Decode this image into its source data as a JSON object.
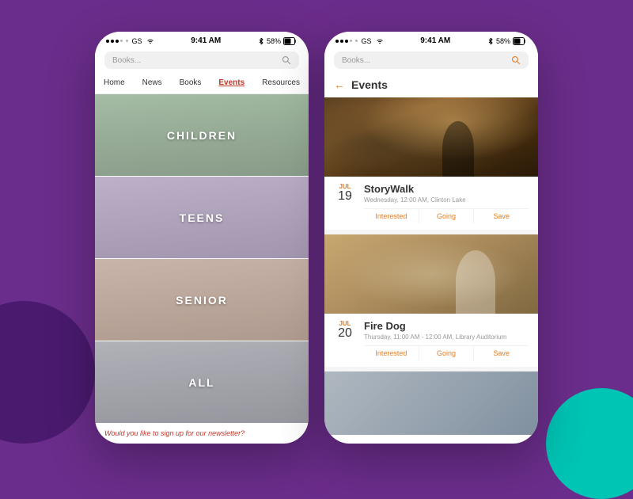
{
  "background": {
    "color": "#6b2d8b"
  },
  "phone1": {
    "statusBar": {
      "carrier": "●●●○○ GS",
      "wifi": "WiFi",
      "time": "9:41 AM",
      "bluetooth": "BT",
      "battery": "58%"
    },
    "search": {
      "placeholder": "Books..."
    },
    "nav": {
      "items": [
        "Home",
        "News",
        "Books",
        "Events",
        "Resources"
      ],
      "activeIndex": 3
    },
    "categories": [
      {
        "id": "children",
        "label": "CHILDREN"
      },
      {
        "id": "teens",
        "label": "TEENS"
      },
      {
        "id": "senior",
        "label": "SENIOR"
      },
      {
        "id": "all",
        "label": "ALL"
      }
    ],
    "newsletter": {
      "text": "Would you like to sign up for our newsletter?"
    }
  },
  "phone2": {
    "statusBar": {
      "carrier": "●●●○○ GS",
      "wifi": "WiFi",
      "time": "9:41 AM",
      "bluetooth": "BT",
      "battery": "58%"
    },
    "search": {
      "placeholder": "Books..."
    },
    "header": {
      "backLabel": "←",
      "title": "Events"
    },
    "events": [
      {
        "id": "storywalk",
        "month": "JUL",
        "day": "19",
        "name": "StoryWalk",
        "when": "Wednesday, 12:00 AM, Clinton Lake",
        "actions": [
          "Interested",
          "Going",
          "Save"
        ]
      },
      {
        "id": "firedog",
        "month": "JUL",
        "day": "20",
        "name": "Fire Dog",
        "when": "Thursday, 11:00 AM - 12:00 AM, Library Auditorium",
        "actions": [
          "Interested",
          "Going",
          "Save"
        ]
      }
    ]
  }
}
